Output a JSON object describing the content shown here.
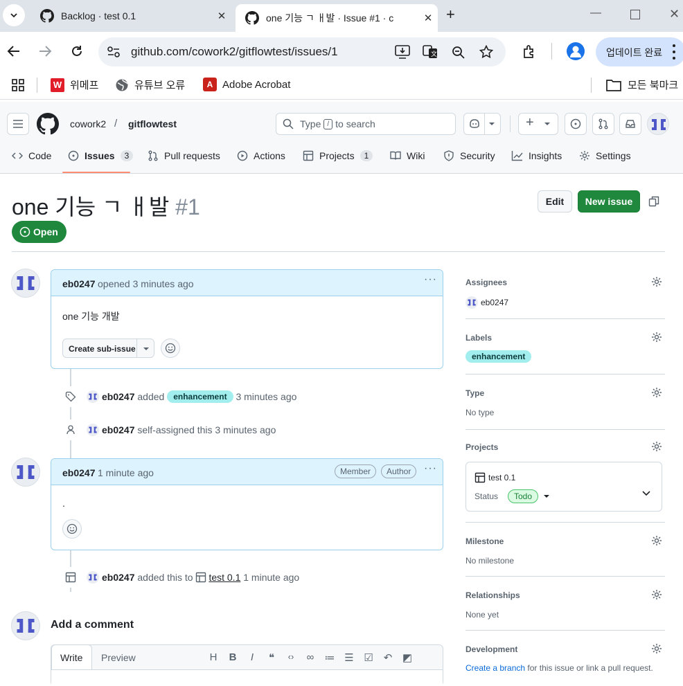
{
  "browser": {
    "tabs": [
      {
        "title": "Backlog · test 0.1"
      },
      {
        "title": "one 기능 ㄱ ㅐ발 · Issue #1 · c"
      }
    ],
    "url": "github.com/cowork2/gitflowtest/issues/1",
    "update_label": "업데이트 완료",
    "bookmarks": [
      "위메프",
      "유튜브 오류",
      "Adobe Acrobat"
    ],
    "all_bookmarks": "모든 북마크"
  },
  "header": {
    "owner": "cowork2",
    "separator": "/",
    "repo": "gitflowtest",
    "search_placeholder_pre": "Type",
    "search_key": "/",
    "search_placeholder_post": "to search",
    "plus": "+"
  },
  "nav": {
    "code": "Code",
    "issues": "Issues",
    "issues_count": "3",
    "pull_requests": "Pull requests",
    "actions": "Actions",
    "projects": "Projects",
    "projects_count": "1",
    "wiki": "Wiki",
    "security": "Security",
    "insights": "Insights",
    "settings": "Settings"
  },
  "issue": {
    "title": "one 기능 ㄱ ㅐ발",
    "number": "#1",
    "state": "Open",
    "edit_label": "Edit",
    "new_issue_label": "New issue"
  },
  "comments": [
    {
      "author": "eb0247",
      "meta": "opened 3 minutes ago",
      "body": "one 기능 개발",
      "sub_issue_label": "Create sub-issue"
    },
    {
      "author": "eb0247",
      "meta": "1 minute ago",
      "body": ".",
      "badges": [
        "Member",
        "Author"
      ]
    }
  ],
  "timeline": [
    {
      "actor": "eb0247",
      "text": "added",
      "label": "enhancement",
      "time": "3 minutes ago"
    },
    {
      "actor": "eb0247",
      "text": "self-assigned this 3 minutes ago"
    },
    {
      "actor": "eb0247",
      "text": "added this to",
      "project": "test 0.1",
      "time": "1 minute ago"
    }
  ],
  "add_comment": {
    "title": "Add a comment",
    "tab_write": "Write",
    "tab_preview": "Preview"
  },
  "sidebar": {
    "assignees": {
      "heading": "Assignees",
      "value": "eb0247"
    },
    "labels": {
      "heading": "Labels",
      "value": "enhancement"
    },
    "type": {
      "heading": "Type",
      "value": "No type"
    },
    "projects": {
      "heading": "Projects",
      "project": "test 0.1",
      "status_label": "Status",
      "status": "Todo"
    },
    "milestone": {
      "heading": "Milestone",
      "value": "No milestone"
    },
    "relationships": {
      "heading": "Relationships",
      "value": "None yet"
    },
    "development": {
      "heading": "Development",
      "link": "Create a branch",
      "rest": "for this issue or link a pull request."
    }
  },
  "colors": {
    "accent_green": "#1f883d",
    "comment_header": "#ddf4ff",
    "label_enhancement": "#a2eeef",
    "todo_badge": "#dafbe1",
    "link_blue": "#0969da"
  }
}
